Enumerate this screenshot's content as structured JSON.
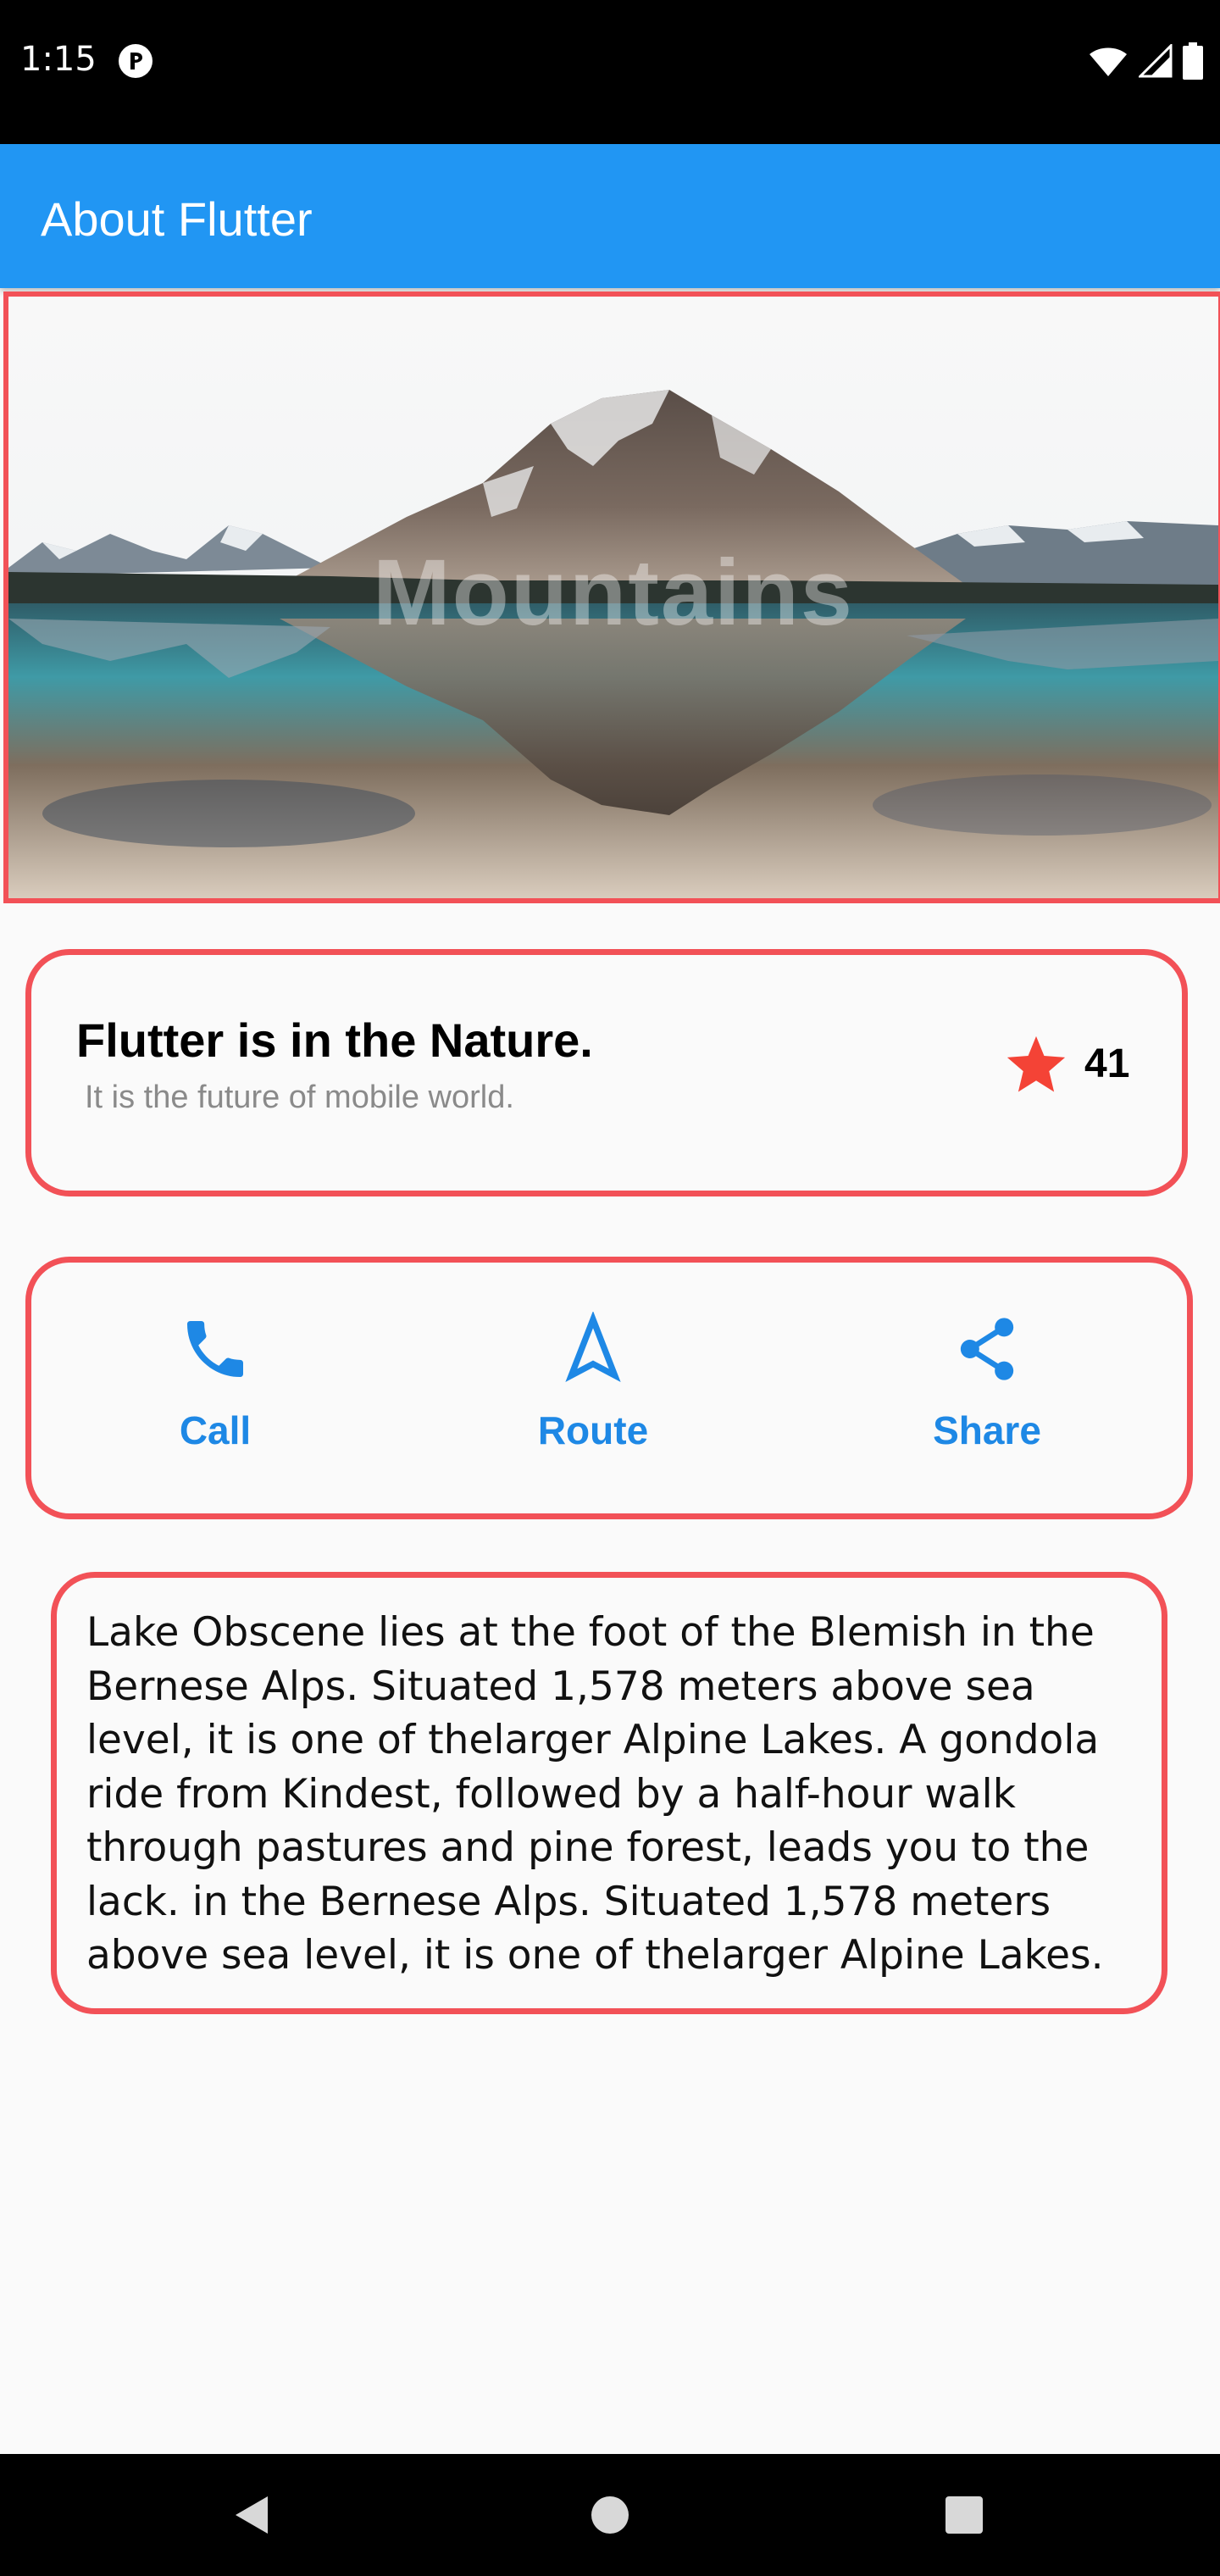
{
  "status_bar": {
    "time": "1:15"
  },
  "app_bar": {
    "title": "About Flutter"
  },
  "hero": {
    "caption": "Mountains"
  },
  "title_card": {
    "heading": "Flutter is in the Nature.",
    "subheading": "It is the future of mobile world.",
    "star_count": "41",
    "star_color": "#f44336"
  },
  "actions": [
    {
      "label": "Call",
      "icon": "phone-icon"
    },
    {
      "label": "Route",
      "icon": "navigation-icon"
    },
    {
      "label": "Share",
      "icon": "share-icon"
    }
  ],
  "description": "Lake Obscene lies at the foot of the Blemish in the Bernese Alps. Situated 1,578 meters above sea level, it is one of thelarger Alpine Lakes. A gondola ride from Kindest, followed by a half-hour walk through pastures and pine forest, leads you to the lack. in the Bernese Alps. Situated 1,578 meters above sea level, it is one of thelarger Alpine Lakes.",
  "colors": {
    "primary": "#2196f3",
    "accent": "#1e88e5",
    "outline": "#f25157",
    "status_bar": "#000000",
    "background": "#fafafa"
  }
}
